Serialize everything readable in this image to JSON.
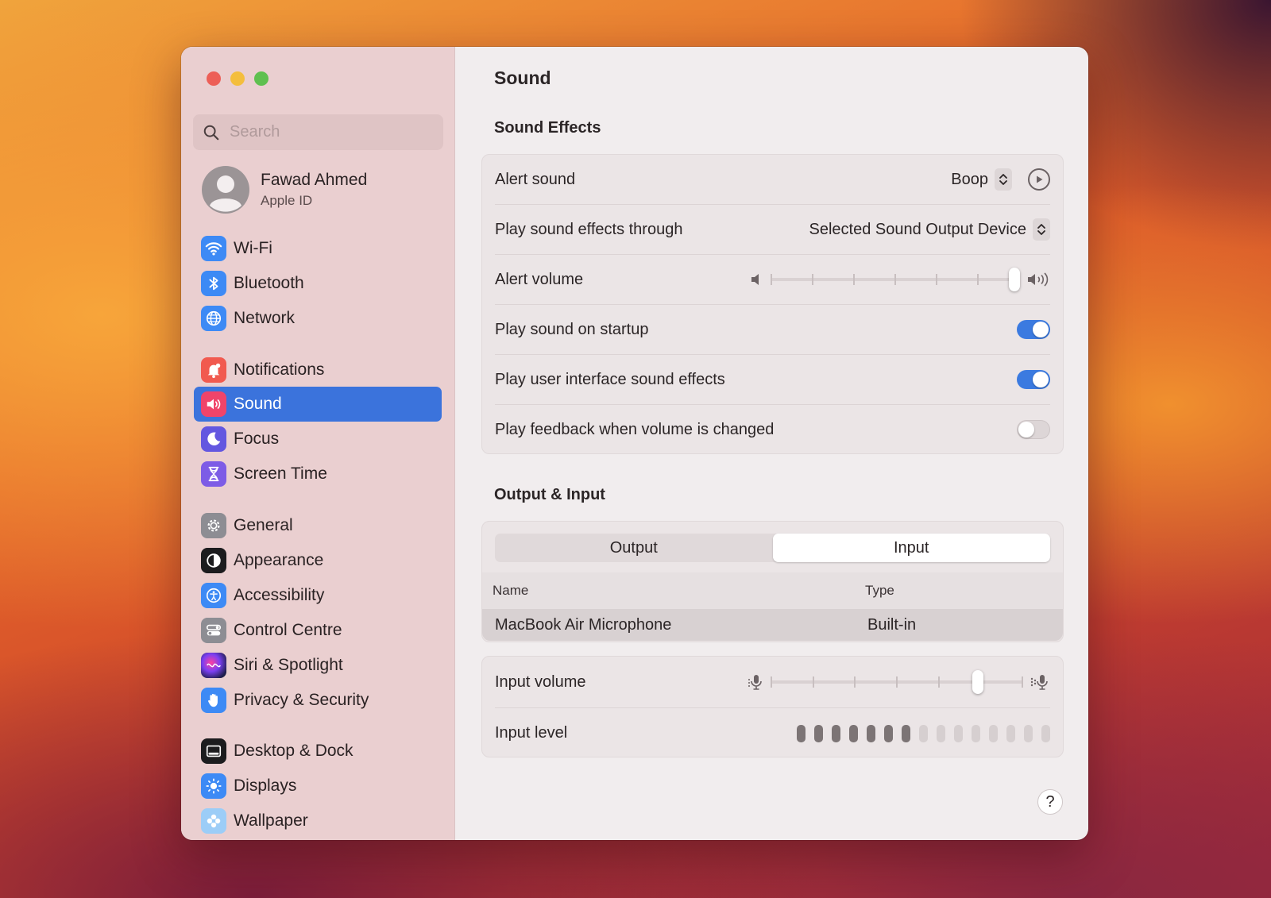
{
  "sidebar": {
    "search_placeholder": "Search",
    "account": {
      "name": "Fawad Ahmed",
      "subtitle": "Apple ID"
    },
    "items": [
      {
        "label": "Wi-Fi",
        "icon": "wifi-icon"
      },
      {
        "label": "Bluetooth",
        "icon": "bluetooth-icon"
      },
      {
        "label": "Network",
        "icon": "globe-icon"
      },
      {
        "label": "Notifications",
        "icon": "bell-icon"
      },
      {
        "label": "Sound",
        "icon": "speaker-icon",
        "active": true
      },
      {
        "label": "Focus",
        "icon": "moon-icon"
      },
      {
        "label": "Screen Time",
        "icon": "hourglass-icon"
      },
      {
        "label": "General",
        "icon": "gear-icon"
      },
      {
        "label": "Appearance",
        "icon": "appearance-icon"
      },
      {
        "label": "Accessibility",
        "icon": "accessibility-icon"
      },
      {
        "label": "Control Centre",
        "icon": "control-centre-icon"
      },
      {
        "label": "Siri & Spotlight",
        "icon": "siri-icon"
      },
      {
        "label": "Privacy & Security",
        "icon": "hand-icon"
      },
      {
        "label": "Desktop & Dock",
        "icon": "dock-icon"
      },
      {
        "label": "Displays",
        "icon": "sun-icon"
      },
      {
        "label": "Wallpaper",
        "icon": "flower-icon"
      }
    ]
  },
  "main": {
    "title": "Sound",
    "sound_effects": {
      "heading": "Sound Effects",
      "alert_sound": {
        "label": "Alert sound",
        "value": "Boop"
      },
      "play_through": {
        "label": "Play sound effects through",
        "value": "Selected Sound Output Device"
      },
      "alert_volume": {
        "label": "Alert volume",
        "level": 1.0
      },
      "startup": {
        "label": "Play sound on startup",
        "on": true
      },
      "ui_effects": {
        "label": "Play user interface sound effects",
        "on": true
      },
      "feedback": {
        "label": "Play feedback when volume is changed",
        "on": false
      }
    },
    "output_input": {
      "heading": "Output & Input",
      "tabs": [
        "Output",
        "Input"
      ],
      "selected_tab": "Input",
      "columns": [
        "Name",
        "Type"
      ],
      "devices": [
        {
          "name": "MacBook Air Microphone",
          "type": "Built-in"
        }
      ]
    },
    "input": {
      "volume_label": "Input volume",
      "volume_level": 0.82,
      "level_label": "Input level",
      "level_lit": 7,
      "level_total": 15
    },
    "help_label": "?"
  },
  "colors": {
    "accent": "#3b73dc",
    "toggle_on": "#3b7ae0",
    "sidebar_bg": "#eacfd0"
  }
}
